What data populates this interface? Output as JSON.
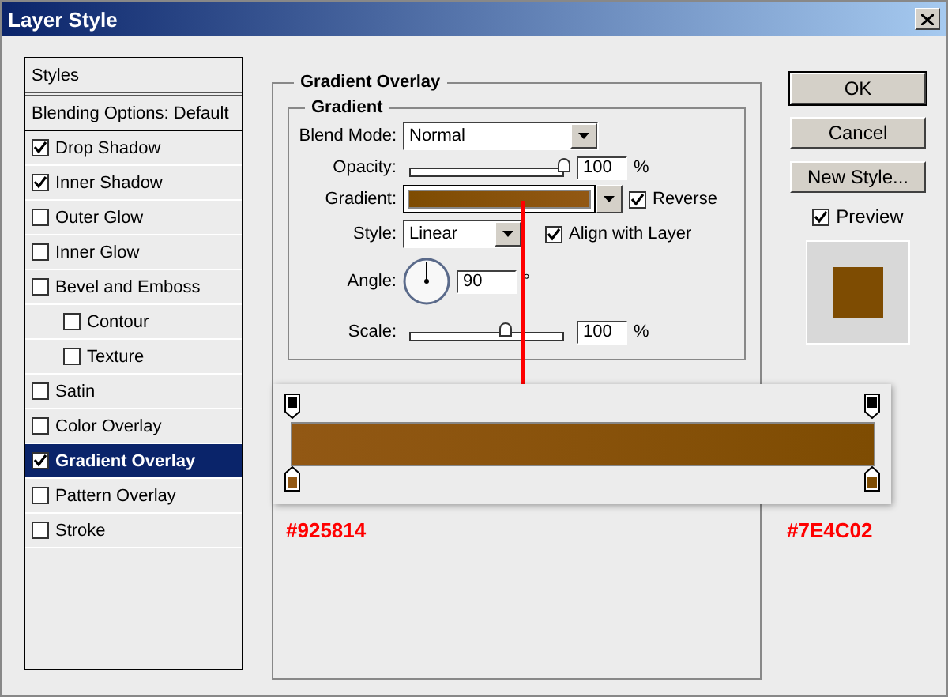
{
  "window": {
    "title": "Layer Style"
  },
  "styles_list": {
    "header": "Styles",
    "items": [
      {
        "label": "Blending Options: Default",
        "kind": "plain",
        "selected": false
      },
      {
        "label": "Drop Shadow",
        "kind": "check",
        "checked": true,
        "selected": false
      },
      {
        "label": "Inner Shadow",
        "kind": "check",
        "checked": true,
        "selected": false
      },
      {
        "label": "Outer Glow",
        "kind": "check",
        "checked": false,
        "selected": false
      },
      {
        "label": "Inner Glow",
        "kind": "check",
        "checked": false,
        "selected": false
      },
      {
        "label": "Bevel and Emboss",
        "kind": "check",
        "checked": false,
        "selected": false,
        "children": [
          {
            "label": "Contour",
            "kind": "check",
            "checked": false,
            "selected": false
          },
          {
            "label": "Texture",
            "kind": "check",
            "checked": false,
            "selected": false
          }
        ]
      },
      {
        "label": "Satin",
        "kind": "check",
        "checked": false,
        "selected": false
      },
      {
        "label": "Color Overlay",
        "kind": "check",
        "checked": false,
        "selected": false
      },
      {
        "label": "Gradient Overlay",
        "kind": "check",
        "checked": true,
        "selected": true
      },
      {
        "label": "Pattern Overlay",
        "kind": "check",
        "checked": false,
        "selected": false
      },
      {
        "label": "Stroke",
        "kind": "check",
        "checked": false,
        "selected": false
      }
    ]
  },
  "gradient_overlay": {
    "title": "Gradient Overlay",
    "group_title": "Gradient",
    "blend_mode": {
      "label": "Blend Mode:",
      "value": "Normal"
    },
    "opacity": {
      "label": "Opacity:",
      "level": 1,
      "value": "100",
      "unit": "%"
    },
    "gradient": {
      "label": "Gradient:",
      "reverse": {
        "label": "Reverse",
        "checked": true
      }
    },
    "style": {
      "label": "Style:",
      "value": "Linear",
      "align": {
        "label": "Align with Layer",
        "checked": true
      }
    },
    "angle": {
      "label": "Angle:",
      "value": "90",
      "unit": "°"
    },
    "scale": {
      "label": "Scale:",
      "level": 0.62,
      "value": "100",
      "unit": "%"
    }
  },
  "buttons": [
    {
      "label": "OK",
      "default": true
    },
    {
      "label": "Cancel",
      "default": false
    },
    {
      "label": "New Style...",
      "default": false
    }
  ],
  "preview": {
    "label": "Preview",
    "checked": true
  },
  "gradient_editor": {
    "stops": [
      {
        "color": "#925814",
        "label": "#925814"
      },
      {
        "color": "#7e4c02",
        "label": "#7E4C02"
      }
    ]
  }
}
